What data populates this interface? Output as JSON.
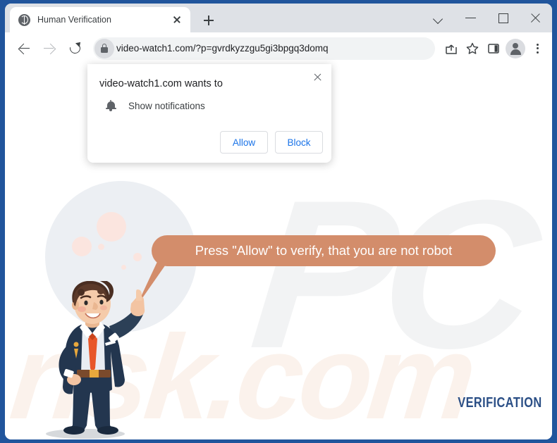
{
  "window": {
    "controls": [
      {
        "name": "tab-search",
        "icon": "chevron-down-icon",
        "label": ""
      },
      {
        "name": "minimize",
        "icon": "minimize-icon",
        "label": ""
      },
      {
        "name": "maximize",
        "icon": "maximize-icon",
        "label": ""
      },
      {
        "name": "close",
        "icon": "close-icon",
        "label": ""
      }
    ]
  },
  "tabstrip": {
    "tab_title": "Human Verification",
    "favicon": "globe-icon",
    "close_icon": "close-icon",
    "new_tab_icon": "plus-icon"
  },
  "toolbar": {
    "back_icon": "arrow-left-icon",
    "forward_icon": "arrow-right-icon",
    "reload_icon": "reload-icon",
    "lock_icon": "lock-icon",
    "url": "video-watch1.com/?p=gvrdkyzzgu5gi3bpgq3domq",
    "share_icon": "share-icon",
    "bookmark_icon": "star-icon",
    "side_panel_icon": "side-panel-icon",
    "profile_icon": "avatar-icon",
    "menu_icon": "three-dot-menu-icon"
  },
  "permission_dialog": {
    "title": "video-watch1.com wants to",
    "permission_icon": "bell-icon",
    "permission_label": "Show notifications",
    "allow_label": "Allow",
    "block_label": "Block",
    "close_icon": "close-icon"
  },
  "page": {
    "bubble_text": "Press \"Allow\" to verify, that you are not robot",
    "verification_label": "VERIFICATION",
    "watermark_primary": "PC",
    "watermark_secondary": "risk.com",
    "character_alt": "cartoon-businessman-pointing-up"
  },
  "colors": {
    "window_frame": "#21559c",
    "bubble": "#d38d6b",
    "link_blue": "#1a73e8",
    "verification_blue": "#2b4f86",
    "suit_navy": "#23364f",
    "tie_orange": "#e8572a"
  }
}
